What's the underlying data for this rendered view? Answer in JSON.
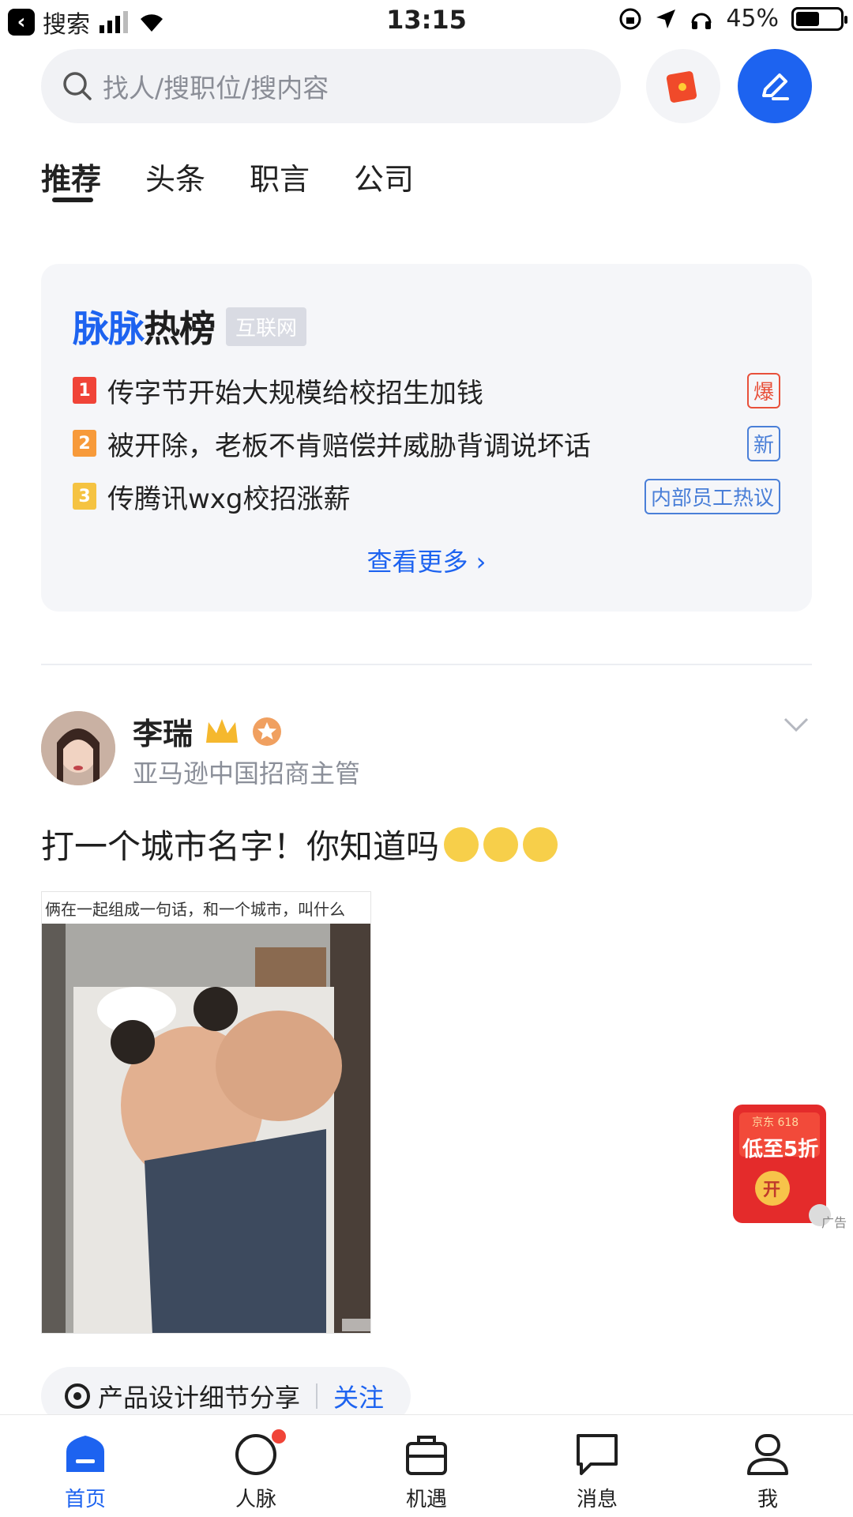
{
  "status_bar": {
    "back_label": "搜索",
    "time": "13:15",
    "battery": "45%"
  },
  "search": {
    "placeholder": "找人/搜职位/搜内容"
  },
  "tabs": [
    {
      "label": "推荐",
      "active": true
    },
    {
      "label": "头条",
      "active": false
    },
    {
      "label": "职言",
      "active": false
    },
    {
      "label": "公司",
      "active": false
    }
  ],
  "hot_list": {
    "title_brand": "脉脉",
    "title_main": "热榜",
    "category": "互联网",
    "items": [
      {
        "rank": "1",
        "text": "传字节开始大规模给校招生加钱",
        "tag": "爆",
        "rank_color": "#f04438",
        "tag_color": "#e8503a"
      },
      {
        "rank": "2",
        "text": "被开除，老板不肯赔偿并威胁背调说坏话",
        "tag": "新",
        "rank_color": "#f79a3a",
        "tag_color": "#4a7fd8"
      },
      {
        "rank": "3",
        "text": "传腾讯wxg校招涨薪",
        "tag": "内部员工热议",
        "rank_color": "#f5c342",
        "tag_color": "#4a7fd8"
      }
    ],
    "more_label": "查看更多 ›"
  },
  "post": {
    "author_name": "李瑞",
    "author_title": "亚马逊中国招商主管",
    "text": "打一个城市名字！你知道吗",
    "image_caption": "俩在一起组成一句话，和一个城市，叫什么",
    "image_watermark": "脉 main"
  },
  "ad": {
    "brand": "京东 618",
    "headline": "低至5折",
    "button": "开",
    "label": "广告"
  },
  "topic": {
    "name": "产品设计细节分享",
    "follow": "关注"
  },
  "bottom_nav": [
    {
      "label": "首页",
      "icon": "home-icon",
      "active": true
    },
    {
      "label": "人脉",
      "icon": "contacts-icon",
      "active": false
    },
    {
      "label": "机遇",
      "icon": "briefcase-icon",
      "active": false
    },
    {
      "label": "消息",
      "icon": "message-icon",
      "active": false
    },
    {
      "label": "我",
      "icon": "profile-icon",
      "active": false
    }
  ],
  "colors": {
    "accent": "#1d63f0",
    "background": "#ffffff",
    "card": "#f5f6f9"
  }
}
